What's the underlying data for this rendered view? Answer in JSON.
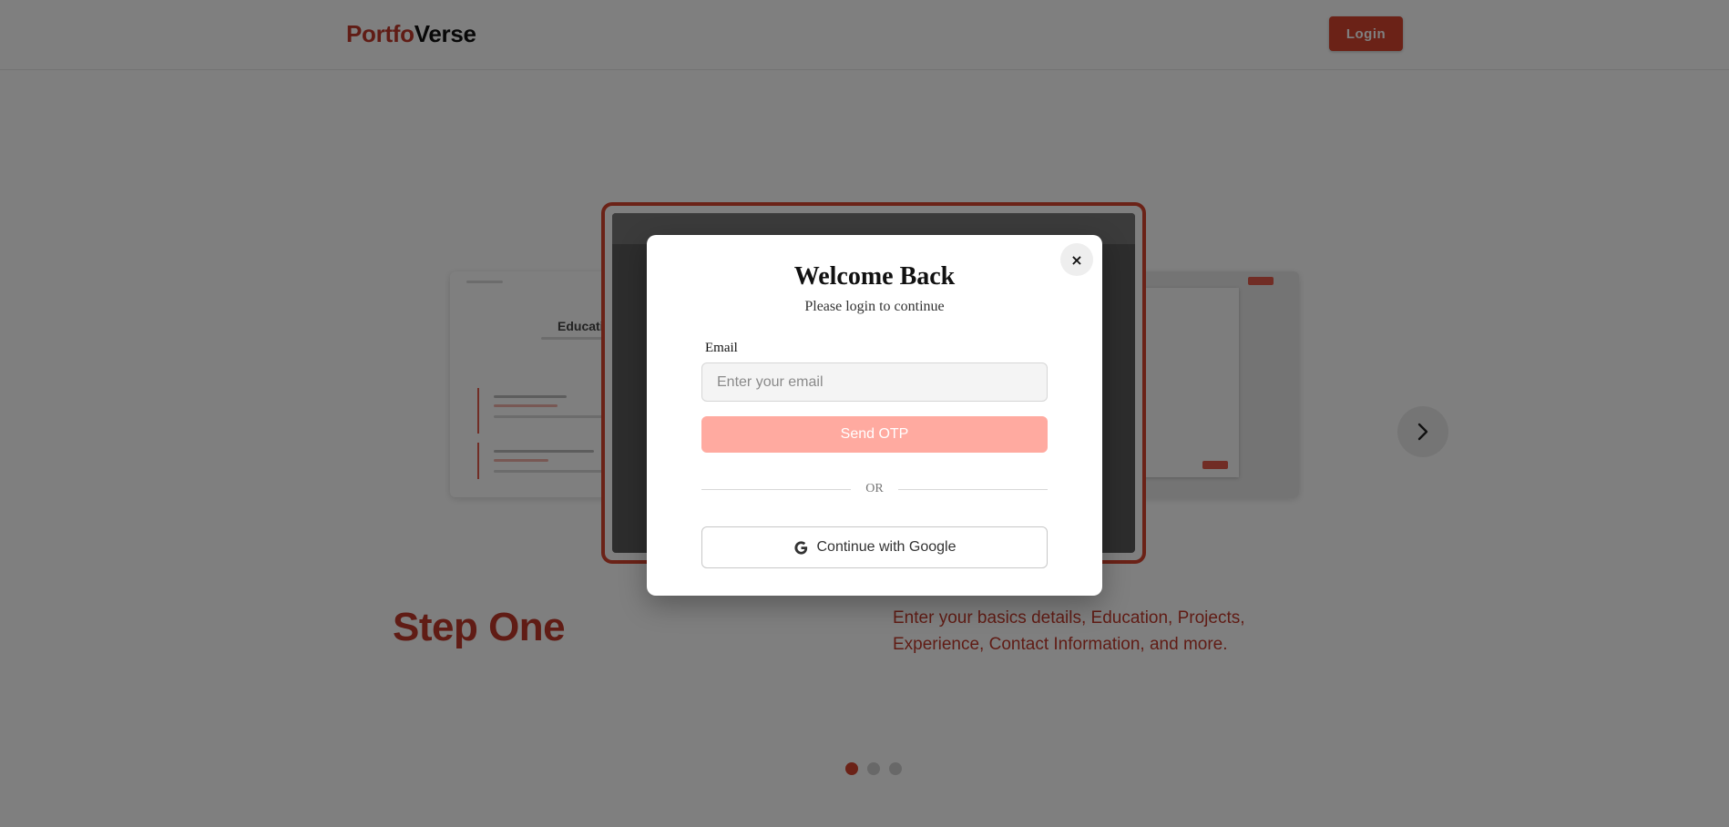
{
  "navbar": {
    "brand_part1": "Portfo",
    "brand_part2": "Verse",
    "login_label": "Login"
  },
  "showcase": {
    "left_card_title": "Education",
    "step_title": "Step One",
    "step_description": "Enter your basics details, Education, Projects, Experience, Contact Information, and more.",
    "slides_total": 3,
    "active_slide": 1
  },
  "modal": {
    "title": "Welcome Back",
    "subtitle": "Please login to continue",
    "close_label": "×",
    "email_label": "Email",
    "email_placeholder": "Enter your email",
    "email_value": "",
    "send_otp_label": "Send OTP",
    "divider_label": "OR",
    "google_label": "Continue with Google"
  },
  "colors": {
    "brand_red": "#c0392b",
    "button_red": "#d6452f",
    "otp_disabled": "#ffaaa0",
    "overlay": "rgba(0,0,0,0.5)"
  },
  "icons": {
    "close": "close-icon",
    "google": "google-icon",
    "next": "chevron-right-icon"
  }
}
